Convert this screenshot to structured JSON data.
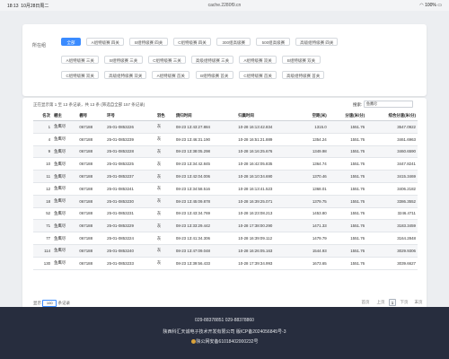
{
  "status": {
    "time": "18:13",
    "date": "10月28日周二",
    "url": "cache.2280f9.cn",
    "battery": "100%"
  },
  "filter": {
    "label": "所在组",
    "rows": [
      [
        "全部",
        "A组特级赛 四关",
        "B组特级赛 四关",
        "C组特级赛 四关",
        "300组高级赛",
        "500组高级赛",
        "高级组特级赛 四关"
      ],
      [
        "A组特级赛 三关",
        "B组特级赛 三关",
        "C组特级赛 三关",
        "高级组特级赛 三关",
        "A组特级赛 双关",
        "B组特级赛 双关"
      ],
      [
        "C组特级赛 双关",
        "高级组特级赛 双关",
        "A组特级赛 首关",
        "B组特级赛 首关",
        "C组特级赛 首关",
        "高级组特级赛 首关"
      ]
    ],
    "active_index": 0
  },
  "table": {
    "summary": "正在显示第 1 至 13 条记录，共 13 条 (筛选自全部 157 条记录)",
    "search_label": "搜索:",
    "search_value": "鱼鹰尽",
    "columns": [
      "名次",
      "棚主",
      "棚号",
      "环号",
      "羽色",
      "鸽归时间",
      "归巢时间",
      "空距(米)",
      "分速(米/分)",
      "综合分速(米/分)"
    ],
    "rows": [
      [
        "1",
        "鱼鹰尽",
        "067188",
        "25-01-0853226",
        "灰",
        "08-23 13:43:27.884",
        "10-28 16:13:42.834",
        "1315.0",
        "1551.76",
        "3547.0922"
      ],
      [
        "4",
        "鱼鹰尽",
        "067188",
        "25-01-0853239",
        "灰",
        "08-23 13:46:31.190",
        "10-28 16:51:21.889",
        "1354.24",
        "1551.76",
        "3461.6963"
      ],
      [
        "9",
        "鱼鹰尽",
        "067188",
        "25-01-0853228",
        "灰",
        "08-23 13:38:05.298",
        "10-28 16:16:25.676",
        "1349.98",
        "1551.76",
        "3460.6590"
      ],
      [
        "10",
        "鱼鹰尽",
        "067188",
        "25-01-0853225",
        "灰",
        "08-23 13:34:42.845",
        "10-28 16:42:05.835",
        "1364.74",
        "1551.76",
        "3447.8241"
      ],
      [
        "11",
        "鱼鹰尽",
        "067188",
        "25-01-0853237",
        "灰",
        "08-23 13:42:04.006",
        "10-28 16:10:34.690",
        "1370.46",
        "1551.76",
        "3415.3469"
      ],
      [
        "12",
        "鱼鹰尽",
        "067188",
        "25-01-0853241",
        "灰",
        "08-23 13:34:58.516",
        "10-28 16:13:41.523",
        "1368.01",
        "1551.76",
        "3406.2182"
      ],
      [
        "18",
        "鱼鹰尽",
        "067188",
        "25-01-0853230",
        "灰",
        "08-23 13:45:09.878",
        "10-28 16:39:25.071",
        "1379.75",
        "1551.76",
        "3386.3552"
      ],
      [
        "52",
        "鱼鹰尽",
        "067188",
        "25-01-0853231",
        "灰",
        "08-23 13:43:34.769",
        "10-28 16:23:08.213",
        "1453.80",
        "1551.76",
        "3246.4711"
      ],
      [
        "71",
        "鱼鹰尽",
        "067188",
        "25-01-0853229",
        "灰",
        "08-23 13:33:29.442",
        "10-28 17:38:00.290",
        "1471.33",
        "1551.76",
        "3183.3459"
      ],
      [
        "77",
        "鱼鹰尽",
        "067188",
        "25-01-0853224",
        "灰",
        "08-23 13:41:34.306",
        "10-28 16:39:09.112",
        "1479.79",
        "1551.76",
        "3164.2848"
      ],
      [
        "114",
        "鱼鹰尽",
        "067188",
        "25-01-0853240",
        "灰",
        "08-23 13:47:09.048",
        "10-28 16:26:05.163",
        "1544.93",
        "1551.76",
        "3029.9306"
      ],
      [
        "130",
        "鱼鹰尽",
        "067188",
        "25-01-0853233",
        "灰",
        "08-23 13:39:56.433",
        "10-28 17:39:34.993",
        "1673.65",
        "1551.76",
        "3039.6627"
      ]
    ],
    "page_size_prefix": "显示",
    "page_size": "100",
    "page_size_suffix": "条记录",
    "pager": {
      "first": "首页",
      "prev": "上页",
      "current": "1",
      "next": "下页",
      "last": "末页"
    }
  },
  "footer": {
    "phones": "029-88378851    029-88378860",
    "company": "陕西科汇天诚电子技术开发有限公司 版ICP备2024056845号-3",
    "police": "陕公网安备61018402000232号"
  }
}
